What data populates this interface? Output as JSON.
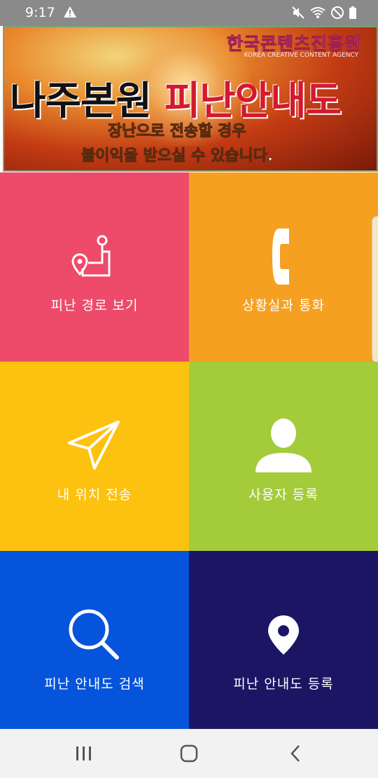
{
  "status_bar": {
    "time": "9:17"
  },
  "banner": {
    "org_kr": "한국콘텐츠진흥원",
    "org_en": "KOREA CREATIVE CONTENT AGENCY",
    "title_black": "나주본원",
    "title_red": "피난안내도",
    "warning_line1": "장난으로 전송할 경우",
    "warning_line2": "불이익을 받으실 수 있습니다."
  },
  "tiles": [
    {
      "label": "피난 경로 보기",
      "icon": "route-icon",
      "color": "#ee4a6a"
    },
    {
      "label": "상황실과 통화",
      "icon": "phone-icon",
      "color": "#f5a021"
    },
    {
      "label": "내 위치 전송",
      "icon": "send-icon",
      "color": "#fdc10f"
    },
    {
      "label": "사용자 등록",
      "icon": "user-icon",
      "color": "#a4cb3a"
    },
    {
      "label": "피난 안내도 검색",
      "icon": "search-icon",
      "color": "#0654db"
    },
    {
      "label": "피난 안내도 등록",
      "icon": "location-pin-icon",
      "color": "#1b1564"
    }
  ],
  "nav": {
    "items": [
      "recent-apps-icon",
      "home-icon",
      "back-icon"
    ]
  }
}
